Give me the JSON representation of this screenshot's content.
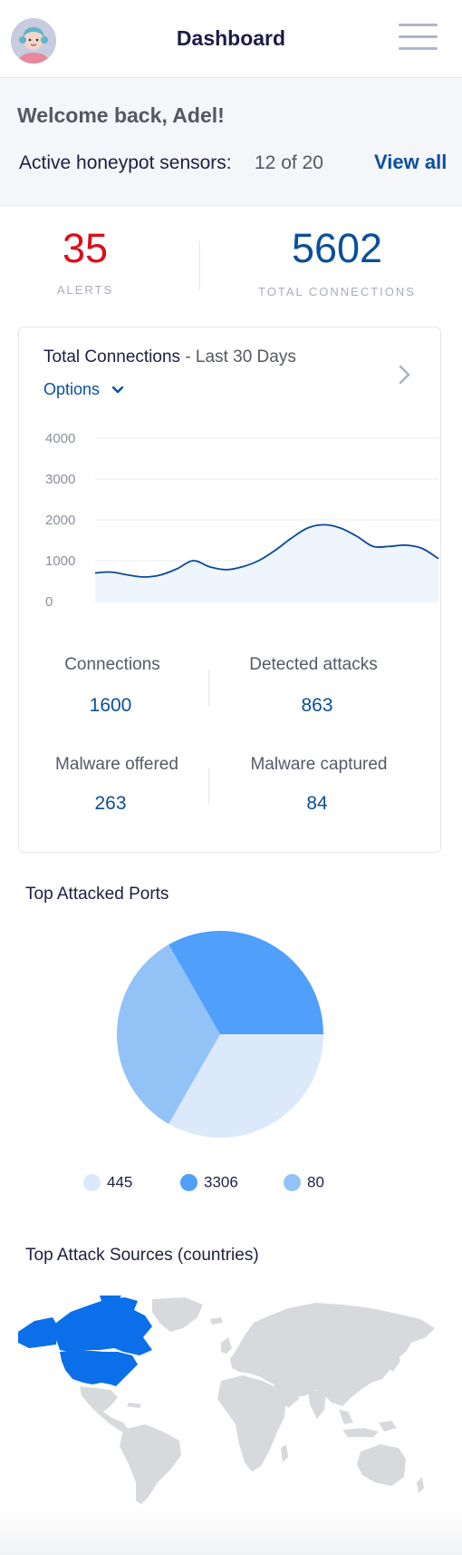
{
  "header": {
    "title": "Dashboard"
  },
  "welcome": {
    "greeting": "Welcome back, Adel!",
    "sensors_label": "Active honeypot sensors:",
    "sensors_value": "12 of 20",
    "view_all": "View all"
  },
  "stats": {
    "alerts_value": "35",
    "alerts_label": "ALERTS",
    "connections_value": "5602",
    "connections_label": "TOTAL CONNECTIONS"
  },
  "connections_card": {
    "title": "Total Connections",
    "subtitle": " - Last 30 Days",
    "options_label": "Options",
    "metrics": [
      {
        "label": "Connections",
        "value": "1600"
      },
      {
        "label": "Detected attacks",
        "value": "863"
      },
      {
        "label": "Malware offered",
        "value": "263"
      },
      {
        "label": "Malware captured",
        "value": "84"
      }
    ]
  },
  "ports": {
    "title": "Top Attacked Ports"
  },
  "sources": {
    "title": "Top Attack Sources (countries)"
  },
  "colors": {
    "accent": "#0b4fa0",
    "alert": "#d8101c",
    "line": "#0b4a97",
    "area_fill": "#eef5fd",
    "pie_445": "#dce9fa",
    "pie_3306": "#4f9ffb",
    "pie_80": "#93c2f6",
    "map_land": "#d7d9dd",
    "map_highlight": "#0a6fe8"
  },
  "chart_data": [
    {
      "type": "area",
      "title": "Total Connections",
      "subtitle": "Last 30 Days",
      "ylim": [
        0,
        4000
      ],
      "y_ticks": [
        "4000",
        "3000",
        "2000",
        "1000",
        "0"
      ],
      "grid": true,
      "series": [
        {
          "values": [
            700,
            720,
            650,
            600,
            650,
            800,
            1000,
            850,
            780,
            850,
            1000,
            1250,
            1550,
            1800,
            1880,
            1800,
            1600,
            1350,
            1350,
            1380,
            1300,
            1050
          ]
        }
      ]
    },
    {
      "type": "pie",
      "title": "Top Attacked Ports",
      "legend_position": "bottom",
      "categories": [
        "445",
        "3306",
        "80"
      ],
      "values": [
        33.3,
        33.3,
        33.4
      ]
    }
  ],
  "map": {
    "highlighted_countries": [
      "Canada",
      "United States"
    ]
  }
}
